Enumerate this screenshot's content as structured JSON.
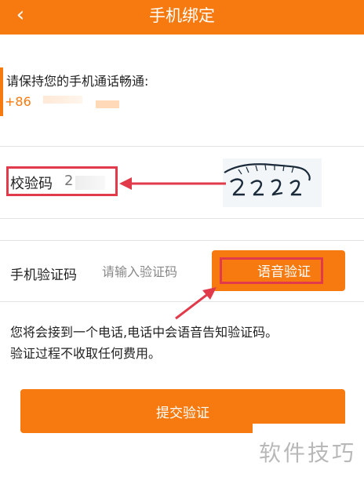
{
  "header": {
    "back_icon": "‹",
    "title": "手机绑定"
  },
  "phone": {
    "hint": "请保持您的手机通话畅通:",
    "number": "+86"
  },
  "captcha": {
    "label": "校验码",
    "value": "2",
    "image_text": "2222"
  },
  "sms": {
    "label": "手机验证码",
    "placeholder": "请输入验证码",
    "voice_button": "语音验证"
  },
  "notice": {
    "line1": "您将会接到一个电话,电话中会语音告知验证码。",
    "line2": "验证过程不收取任何费用。"
  },
  "submit": {
    "label": "提交验证"
  },
  "watermark": {
    "text": "软件技巧"
  },
  "colors": {
    "accent": "#f77a10",
    "annotation": "#e03a4b"
  }
}
